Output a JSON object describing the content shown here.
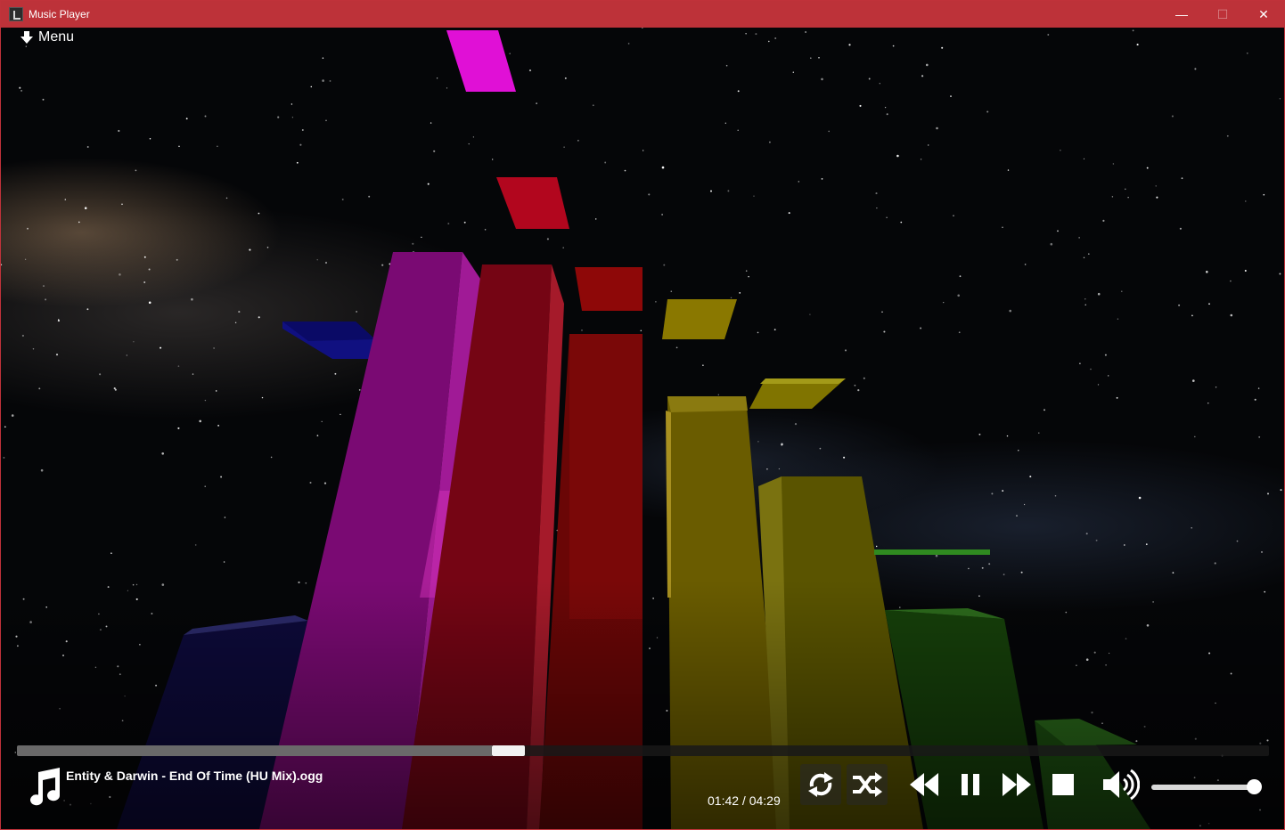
{
  "window": {
    "title": "Music Player",
    "accent_color": "#bd3239",
    "controls": {
      "minimize": "—",
      "maximize": "☐",
      "close": "✕"
    }
  },
  "menu": {
    "label": "Menu",
    "icon": "arrow-down-icon"
  },
  "player": {
    "track_title": "Entity & Darwin - End Of Time (HU Mix).ogg",
    "current_time": "01:42",
    "separator": " / ",
    "duration": "04:29",
    "progress_fraction": 0.3795,
    "volume_fraction": 1.0,
    "buttons": [
      {
        "name": "repeat-button",
        "icon": "repeat-icon"
      },
      {
        "name": "shuffle-button",
        "icon": "shuffle-icon"
      },
      {
        "name": "previous-button",
        "icon": "rewind-icon"
      },
      {
        "name": "pause-button",
        "icon": "pause-icon"
      },
      {
        "name": "next-button",
        "icon": "fast-forward-icon"
      },
      {
        "name": "stop-button",
        "icon": "stop-icon"
      },
      {
        "name": "volume-button",
        "icon": "speaker-icon"
      }
    ]
  },
  "visualizer": {
    "type": "3d-spectrum-bars",
    "colors": [
      "#1a1a7a",
      "#8e0a8a",
      "#8a0a26",
      "#7a0606",
      "#807000",
      "#6e6a00",
      "#1f5a10",
      "#205a10"
    ]
  }
}
